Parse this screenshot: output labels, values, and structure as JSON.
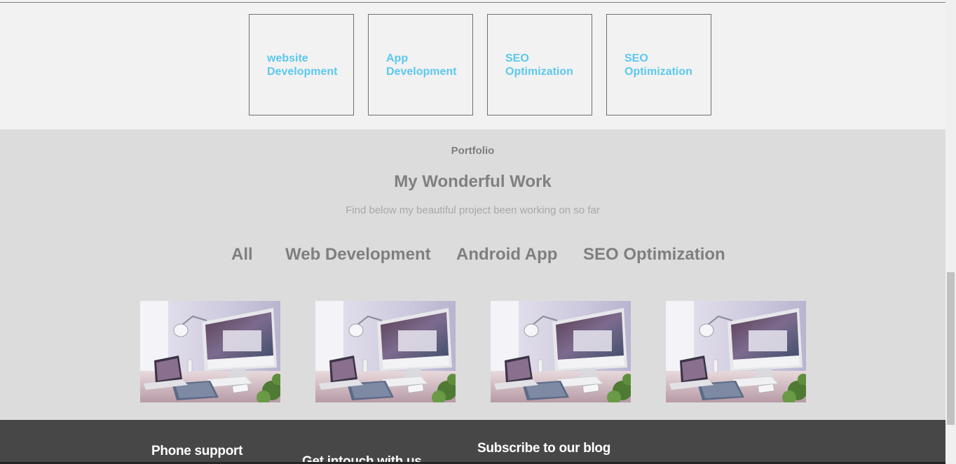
{
  "services": {
    "cards": [
      {
        "label": "website Development"
      },
      {
        "label": "App Development"
      },
      {
        "label": "SEO Optimization"
      },
      {
        "label": "SEO Optimization"
      }
    ],
    "accent_color": "#5bc8ee"
  },
  "portfolio": {
    "eyebrow": "Portfolio",
    "heading": "My Wonderful Work",
    "subtitle": "Find below my beautiful project been working on so far",
    "filters": [
      {
        "label": "All"
      },
      {
        "label": "Web Development"
      },
      {
        "label": "Android App"
      },
      {
        "label": "SEO Optimization"
      }
    ],
    "projects": [
      {
        "image": "desk-workspace-photo"
      },
      {
        "image": "desk-workspace-photo"
      },
      {
        "image": "desk-workspace-photo"
      },
      {
        "image": "desk-workspace-photo"
      }
    ]
  },
  "footer": {
    "phone_support_title": "Phone support",
    "get_in_touch_title": "Get intouch with us",
    "subscribe_title": "Subscribe to our blog",
    "accent_color": "#c8783c"
  }
}
